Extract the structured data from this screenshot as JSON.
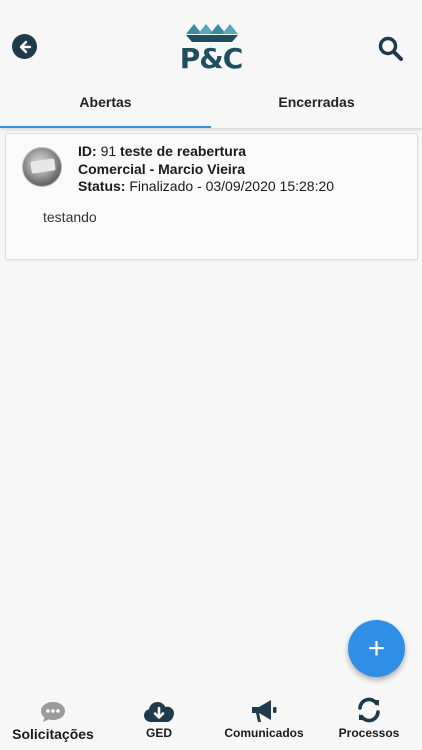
{
  "header": {
    "logo_text": "P&C",
    "back_icon": "arrow-left-icon",
    "search_icon": "search-icon"
  },
  "tabs": [
    {
      "label": "Abertas",
      "active": true
    },
    {
      "label": "Encerradas",
      "active": false
    }
  ],
  "card": {
    "id_label": "ID:",
    "id_value": "91",
    "title": "teste de reabertura",
    "department": "Comercial - Marcio Vieira",
    "status_label": "Status:",
    "status_value": "Finalizado - 03/09/2020 15:28:20",
    "description": "testando"
  },
  "fab": {
    "label": "+"
  },
  "bottom_nav": [
    {
      "label": "Solicitações",
      "icon": "chat-icon",
      "active": true
    },
    {
      "label": "GED",
      "icon": "cloud-download-icon",
      "active": false
    },
    {
      "label": "Comunicados",
      "icon": "megaphone-icon",
      "active": false
    },
    {
      "label": "Processos",
      "icon": "sync-icon",
      "active": false
    }
  ],
  "colors": {
    "accent": "#2f8fe6",
    "tab_indicator": "#3a8fd9",
    "brand": "#1f4e5f"
  }
}
